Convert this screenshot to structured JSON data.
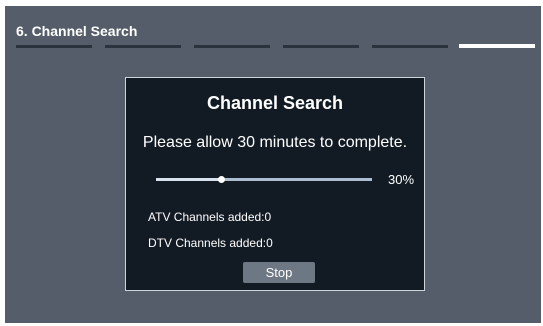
{
  "header": {
    "step_title": "6. Channel Search",
    "steps": [
      {
        "active": false
      },
      {
        "active": false
      },
      {
        "active": false
      },
      {
        "active": false
      },
      {
        "active": false
      },
      {
        "active": true
      }
    ]
  },
  "dialog": {
    "title": "Channel Search",
    "message": "Please allow 30 minutes to complete.",
    "progress_fraction": 0.3,
    "progress_label": "30%",
    "atv_label": "ATV Channels added:0",
    "dtv_label": "DTV Channels added:0",
    "stop_label": "Stop"
  },
  "colors": {
    "background": "#545d69",
    "dialog_bg": "#121a24",
    "step_inactive": "#2a323e",
    "step_active": "#ffffff",
    "button_bg": "#6e7884"
  }
}
